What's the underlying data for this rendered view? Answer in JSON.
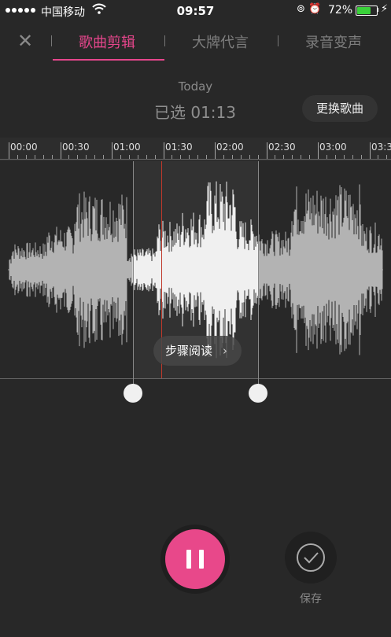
{
  "status_bar": {
    "carrier": "中国移动",
    "time": "09:57",
    "battery_percent": "72%",
    "battery_level": 0.72,
    "icons": [
      "signal-dots-icon",
      "wifi-icon",
      "rotation-lock-icon",
      "alarm-icon",
      "battery-icon",
      "charging-bolt-icon"
    ]
  },
  "tabs": {
    "close_icon": "close-icon",
    "items": [
      {
        "label": "歌曲剪辑",
        "active": true
      },
      {
        "label": "大牌代言",
        "active": false
      },
      {
        "label": "录音变声",
        "active": false
      }
    ]
  },
  "header": {
    "song_title": "Today",
    "selected_text": "已选 01:13",
    "swap_button": "更换歌曲"
  },
  "timeline": {
    "labels": [
      "00:00",
      "00:30",
      "01:00",
      "01:30",
      "02:00",
      "02:30",
      "03:00",
      "03:3"
    ]
  },
  "guide": {
    "label": "步骤阅读",
    "arrow_icon": "chevron-right-icon"
  },
  "controls": {
    "pause_icon": "pause-icon",
    "save_icon": "checkmark-icon",
    "save_label": "保存"
  },
  "colors": {
    "accent": "#e6468c",
    "background": "#282828",
    "waveform": "#b3b3b3",
    "waveform_selected": "#f0f0f0",
    "playhead": "#c0392b",
    "battery": "#3ad13a"
  }
}
